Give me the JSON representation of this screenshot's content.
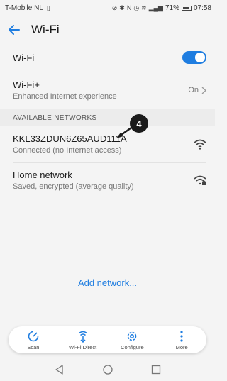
{
  "status_bar": {
    "carrier": "T-Mobile  NL",
    "battery_percent": "71%",
    "time": "07:58"
  },
  "app_bar": {
    "title": "Wi-Fi"
  },
  "wifi_row": {
    "label": "Wi-Fi",
    "enabled": true
  },
  "wifi_plus": {
    "label": "Wi-Fi+",
    "description": "Enhanced Internet experience",
    "value": "On"
  },
  "available_networks": {
    "header": "AVAILABLE NETWORKS",
    "networks": [
      {
        "name": "KKL33ZDUN6Z65AUD111A",
        "status": "Connected (no Internet access)",
        "icon": "wifi-signal-icon"
      },
      {
        "name": "Home network",
        "status": "Saved, encrypted (average quality)",
        "icon": "wifi-locked-icon"
      }
    ]
  },
  "annotation": {
    "badge": "4"
  },
  "add_network": "Add network...",
  "bottom_actions": [
    {
      "label": "Scan",
      "icon": "scan-icon"
    },
    {
      "label": "Wi-Fi Direct",
      "icon": "wifi-direct-icon"
    },
    {
      "label": "Configure",
      "icon": "gear-icon"
    },
    {
      "label": "More",
      "icon": "more-icon"
    }
  ],
  "colors": {
    "accent": "#1f7de0",
    "background": "#f4f4f4",
    "badge": "#1b1b1b"
  }
}
